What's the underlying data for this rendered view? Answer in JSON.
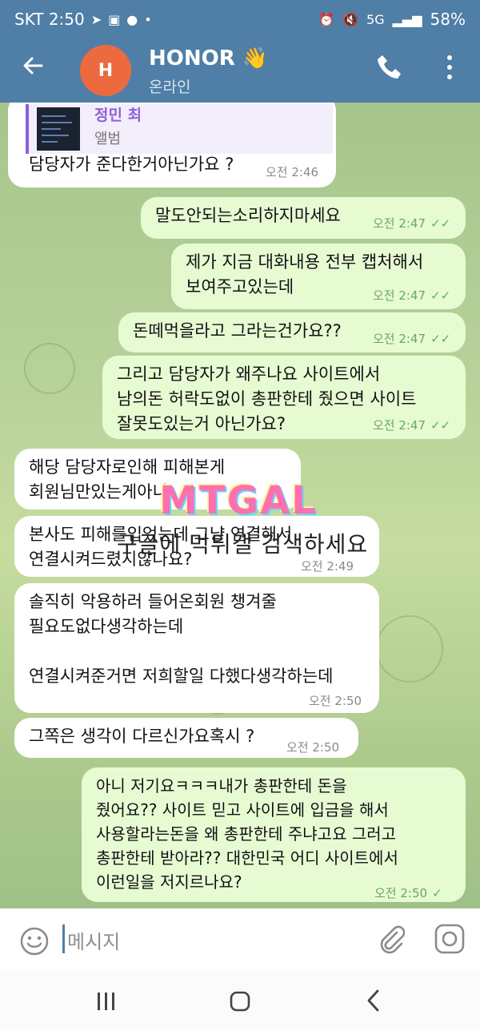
{
  "status_bar": {
    "carrier_time": "SKT 2:50",
    "battery": "58%",
    "network": "5G"
  },
  "header": {
    "avatar_letter": "H",
    "name": "HONOR",
    "name_emoji": "👋",
    "status": "온라인"
  },
  "reply_preview": {
    "name": "정민 최",
    "subtitle": "앨범"
  },
  "messages": [
    {
      "dir": "in",
      "lines": [
        "담당자가 준다한거아닌가요 ?"
      ],
      "time": "오전 2:46"
    },
    {
      "dir": "out",
      "lines": [
        "말도안되는소리하지마세요"
      ],
      "time": "오전 2:47"
    },
    {
      "dir": "out",
      "lines": [
        "제가 지금 대화내용 전부 캡처해서",
        "보여주고있는데"
      ],
      "time": "오전 2:47"
    },
    {
      "dir": "out",
      "lines": [
        "돈떼먹을라고 그라는건가요??"
      ],
      "time": "오전 2:47"
    },
    {
      "dir": "out",
      "lines": [
        "그리고 담당자가 왜주나요 사이트에서",
        "남의돈 허락도없이 총판한테 줬으면 사이트",
        "잘못도있는거 아닌가요?"
      ],
      "time": "오전 2:47"
    },
    {
      "dir": "in",
      "lines": [
        "해당 담당자로인해 피해본게",
        "회원님만있는게아니"
      ],
      "time": ""
    },
    {
      "dir": "in",
      "lines": [
        "본사도 피해를입었는데 그냥 연결해서",
        "연결시켜드렸지않나요?"
      ],
      "time": "오전 2:49"
    },
    {
      "dir": "in",
      "lines": [
        "솔직히 악용하러 들어온회원 챙겨줄",
        "필요도없다생각하는데",
        "",
        "연결시켜준거면 저희할일 다했다생각하는데"
      ],
      "time": "오전 2:50"
    },
    {
      "dir": "in",
      "lines": [
        "그쪽은 생각이 다르신가요혹시 ?"
      ],
      "time": "오전 2:50"
    },
    {
      "dir": "out",
      "lines": [
        "아니 저기요ㅋㅋㅋ내가 총판한테 돈을",
        "줬어요?? 사이트 믿고 사이트에 입금을 해서",
        "사용할라는돈을 왜 총판한테 주냐고요 그러고",
        "총판한테 받아라?? 대한민국 어디 사이트에서",
        "이런일을 저지르나요?"
      ],
      "time": "오전 2:50"
    }
  ],
  "watermark": {
    "logo": "MTGAL",
    "text": "구글에 먹튀갤 검색하세요"
  },
  "input": {
    "placeholder": "메시지"
  }
}
